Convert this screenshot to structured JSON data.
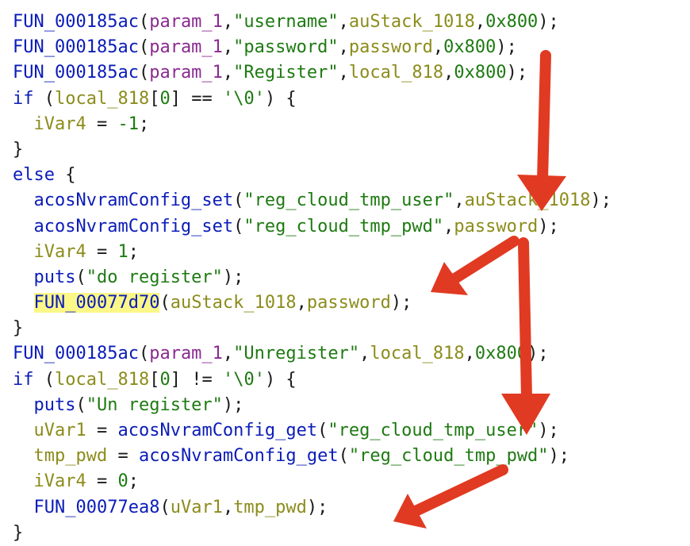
{
  "colors": {
    "background": "#ffffff",
    "function": "#0b1cb8",
    "variable": "#8c8c1c",
    "parameter": "#8a2a91",
    "string": "#1e7a12",
    "number": "#1e7a12",
    "keyword": "#0b1cb8",
    "plain": "#1a1a1a",
    "highlight": "#fbf788",
    "arrow": "#e13a22"
  },
  "code": {
    "lines": [
      [
        {
          "t": "FUN_000185ac",
          "k": "fn"
        },
        {
          "t": "(",
          "k": "pl"
        },
        {
          "t": "param_1",
          "k": "prm"
        },
        {
          "t": ",",
          "k": "pl"
        },
        {
          "t": "\"username\"",
          "k": "str"
        },
        {
          "t": ",",
          "k": "pl"
        },
        {
          "t": "auStack_1018",
          "k": "var"
        },
        {
          "t": ",",
          "k": "pl"
        },
        {
          "t": "0x800",
          "k": "num"
        },
        {
          "t": ");",
          "k": "pl"
        }
      ],
      [
        {
          "t": "FUN_000185ac",
          "k": "fn"
        },
        {
          "t": "(",
          "k": "pl"
        },
        {
          "t": "param_1",
          "k": "prm"
        },
        {
          "t": ",",
          "k": "pl"
        },
        {
          "t": "\"password\"",
          "k": "str"
        },
        {
          "t": ",",
          "k": "pl"
        },
        {
          "t": "password",
          "k": "var"
        },
        {
          "t": ",",
          "k": "pl"
        },
        {
          "t": "0x800",
          "k": "num"
        },
        {
          "t": ");",
          "k": "pl"
        }
      ],
      [
        {
          "t": "FUN_000185ac",
          "k": "fn"
        },
        {
          "t": "(",
          "k": "pl"
        },
        {
          "t": "param_1",
          "k": "prm"
        },
        {
          "t": ",",
          "k": "pl"
        },
        {
          "t": "\"Register\"",
          "k": "str"
        },
        {
          "t": ",",
          "k": "pl"
        },
        {
          "t": "local_818",
          "k": "var"
        },
        {
          "t": ",",
          "k": "pl"
        },
        {
          "t": "0x800",
          "k": "num"
        },
        {
          "t": ");",
          "k": "pl"
        }
      ],
      [
        {
          "t": "if",
          "k": "kw"
        },
        {
          "t": " (",
          "k": "pl"
        },
        {
          "t": "local_818",
          "k": "var"
        },
        {
          "t": "[",
          "k": "pl"
        },
        {
          "t": "0",
          "k": "num"
        },
        {
          "t": "] == ",
          "k": "pl"
        },
        {
          "t": "'\\0'",
          "k": "str"
        },
        {
          "t": ") {",
          "k": "pl"
        }
      ],
      [
        {
          "t": "  ",
          "k": "pl"
        },
        {
          "t": "iVar4",
          "k": "var"
        },
        {
          "t": " = ",
          "k": "pl"
        },
        {
          "t": "-1",
          "k": "num"
        },
        {
          "t": ";",
          "k": "pl"
        }
      ],
      [
        {
          "t": "}",
          "k": "pl"
        }
      ],
      [
        {
          "t": "else",
          "k": "kw"
        },
        {
          "t": " {",
          "k": "pl"
        }
      ],
      [
        {
          "t": "  ",
          "k": "pl"
        },
        {
          "t": "acosNvramConfig_set",
          "k": "fn"
        },
        {
          "t": "(",
          "k": "pl"
        },
        {
          "t": "\"reg_cloud_tmp_user\"",
          "k": "str"
        },
        {
          "t": ",",
          "k": "pl"
        },
        {
          "t": "auStack_1018",
          "k": "var"
        },
        {
          "t": ");",
          "k": "pl"
        }
      ],
      [
        {
          "t": "  ",
          "k": "pl"
        },
        {
          "t": "acosNvramConfig_set",
          "k": "fn"
        },
        {
          "t": "(",
          "k": "pl"
        },
        {
          "t": "\"reg_cloud_tmp_pwd\"",
          "k": "str"
        },
        {
          "t": ",",
          "k": "pl"
        },
        {
          "t": "password",
          "k": "var"
        },
        {
          "t": ");",
          "k": "pl"
        }
      ],
      [
        {
          "t": "  ",
          "k": "pl"
        },
        {
          "t": "iVar4",
          "k": "var"
        },
        {
          "t": " = ",
          "k": "pl"
        },
        {
          "t": "1",
          "k": "num"
        },
        {
          "t": ";",
          "k": "pl"
        }
      ],
      [
        {
          "t": "  ",
          "k": "pl"
        },
        {
          "t": "puts",
          "k": "fn"
        },
        {
          "t": "(",
          "k": "pl"
        },
        {
          "t": "\"do register\"",
          "k": "str"
        },
        {
          "t": ");",
          "k": "pl"
        }
      ],
      [
        {
          "t": "  ",
          "k": "pl"
        },
        {
          "t": "FUN_00077d70",
          "k": "fn",
          "hl": true
        },
        {
          "t": "(",
          "k": "pl"
        },
        {
          "t": "auStack_1018",
          "k": "var"
        },
        {
          "t": ",",
          "k": "pl"
        },
        {
          "t": "password",
          "k": "var"
        },
        {
          "t": ");",
          "k": "pl"
        }
      ],
      [
        {
          "t": "}",
          "k": "pl"
        }
      ],
      [
        {
          "t": "FUN_000185ac",
          "k": "fn"
        },
        {
          "t": "(",
          "k": "pl"
        },
        {
          "t": "param_1",
          "k": "prm"
        },
        {
          "t": ",",
          "k": "pl"
        },
        {
          "t": "\"Unregister\"",
          "k": "str"
        },
        {
          "t": ",",
          "k": "pl"
        },
        {
          "t": "local_818",
          "k": "var"
        },
        {
          "t": ",",
          "k": "pl"
        },
        {
          "t": "0x800",
          "k": "num"
        },
        {
          "t": ");",
          "k": "pl"
        }
      ],
      [
        {
          "t": "if",
          "k": "kw"
        },
        {
          "t": " (",
          "k": "pl"
        },
        {
          "t": "local_818",
          "k": "var"
        },
        {
          "t": "[",
          "k": "pl"
        },
        {
          "t": "0",
          "k": "num"
        },
        {
          "t": "] != ",
          "k": "pl"
        },
        {
          "t": "'\\0'",
          "k": "str"
        },
        {
          "t": ") {",
          "k": "pl"
        }
      ],
      [
        {
          "t": "  ",
          "k": "pl"
        },
        {
          "t": "puts",
          "k": "fn"
        },
        {
          "t": "(",
          "k": "pl"
        },
        {
          "t": "\"Un register\"",
          "k": "str"
        },
        {
          "t": ");",
          "k": "pl"
        }
      ],
      [
        {
          "t": "  ",
          "k": "pl"
        },
        {
          "t": "uVar1",
          "k": "var"
        },
        {
          "t": " = ",
          "k": "pl"
        },
        {
          "t": "acosNvramConfig_get",
          "k": "fn"
        },
        {
          "t": "(",
          "k": "pl"
        },
        {
          "t": "\"reg_cloud_tmp_user\"",
          "k": "str"
        },
        {
          "t": ");",
          "k": "pl"
        }
      ],
      [
        {
          "t": "  ",
          "k": "pl"
        },
        {
          "t": "tmp_pwd",
          "k": "var"
        },
        {
          "t": " = ",
          "k": "pl"
        },
        {
          "t": "acosNvramConfig_get",
          "k": "fn"
        },
        {
          "t": "(",
          "k": "pl"
        },
        {
          "t": "\"reg_cloud_tmp_pwd\"",
          "k": "str"
        },
        {
          "t": ");",
          "k": "pl"
        }
      ],
      [
        {
          "t": "  ",
          "k": "pl"
        },
        {
          "t": "iVar4",
          "k": "var"
        },
        {
          "t": " = ",
          "k": "pl"
        },
        {
          "t": "0",
          "k": "num"
        },
        {
          "t": ";",
          "k": "pl"
        }
      ],
      [
        {
          "t": "  ",
          "k": "pl"
        },
        {
          "t": "FUN_00077ea8",
          "k": "fn"
        },
        {
          "t": "(",
          "k": "pl"
        },
        {
          "t": "uVar1",
          "k": "var"
        },
        {
          "t": ",",
          "k": "pl"
        },
        {
          "t": "tmp_pwd",
          "k": "var"
        },
        {
          "t": ");",
          "k": "pl"
        }
      ],
      [
        {
          "t": "}",
          "k": "pl"
        }
      ]
    ]
  },
  "annotations": {
    "icon": "arrow-icon",
    "count": 4
  }
}
